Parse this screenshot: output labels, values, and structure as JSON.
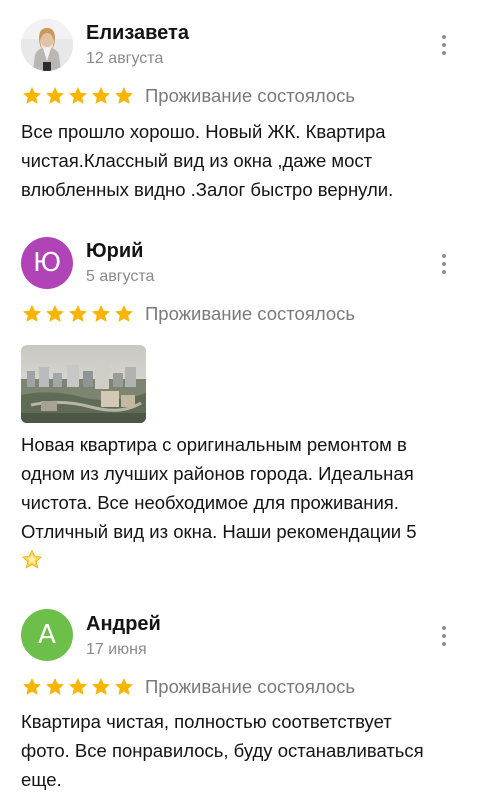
{
  "reviews": [
    {
      "author": "Елизавета",
      "date": "12 августа",
      "rating": 5,
      "status": "Проживание состоялось",
      "avatar_type": "photo",
      "text_lines": [
        "Все прошло хорошо. Новый ЖК. Квартира",
        "чистая.Классный вид из окна ,даже мост",
        "влюбленных видно  .Залог быстро вернули."
      ]
    },
    {
      "author": "Юрий",
      "date": "5 августа",
      "rating": 5,
      "status": "Проживание состоялось",
      "avatar_type": "letter",
      "avatar_letter": "Ю",
      "avatar_color": "#b043b6",
      "photos": [
        "city-view-photo"
      ],
      "text_lines": [
        "Новая квартира с оригинальным ремонтом в",
        "одном из лучших районов города. Идеальная",
        "чистота. Все необходимое для проживания.",
        "Отличный вид из окна. Наши рекомендации 5"
      ],
      "trailing_emoji": "glowing-star-icon"
    },
    {
      "author": "Андрей",
      "date": "17 июня",
      "rating": 5,
      "status": "Проживание состоялось",
      "avatar_type": "letter",
      "avatar_letter": "А",
      "avatar_color": "#6cc04a",
      "text_lines": [
        "Квартира чистая, полностью соответствует",
        "фото. Все понравилось, буду останавливаться",
        "еще."
      ]
    }
  ],
  "colors": {
    "star": "#f7b500",
    "status_text": "#7a7a7a",
    "date_text": "#8a8a8a",
    "menu_dots": "#8f8f8f"
  }
}
